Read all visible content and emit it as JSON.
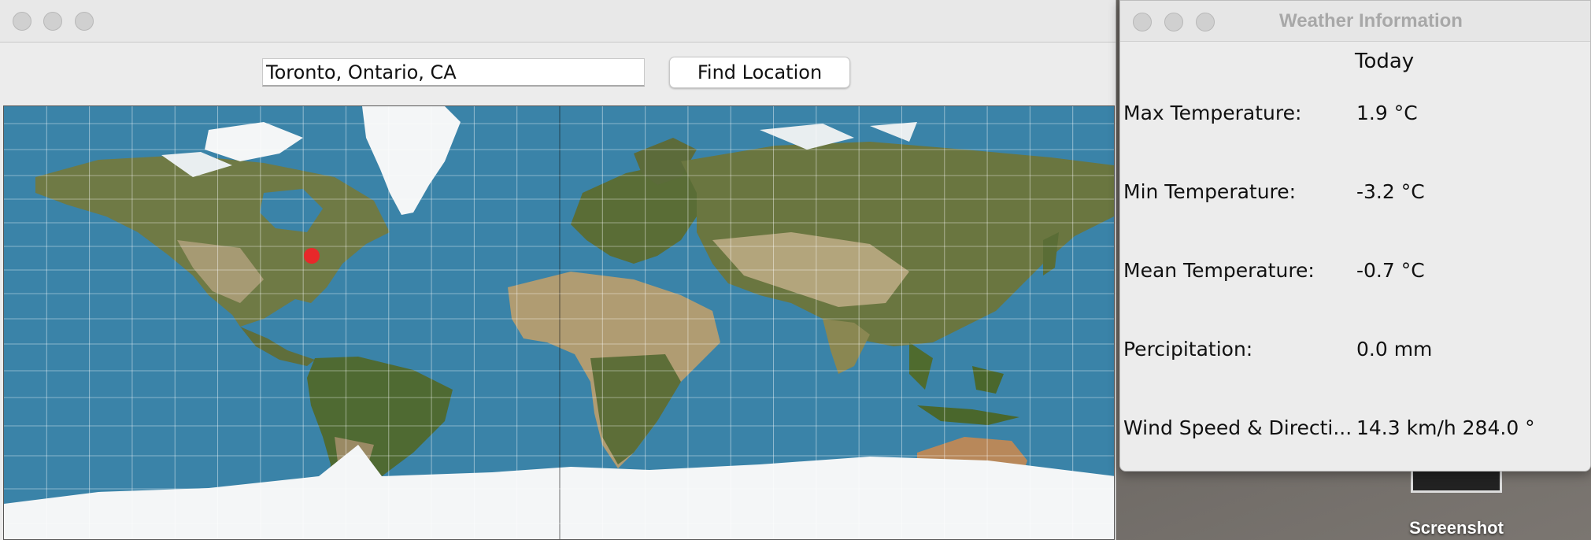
{
  "map_window": {
    "location_input_value": "Toronto, Ontario, CA",
    "find_button_label": "Find Location",
    "map": {
      "marker_color": "#e8282a",
      "ocean_color": "#3a83a8",
      "ice_color": "#f4f6f7"
    }
  },
  "weather_window": {
    "title": "Weather Information",
    "column_header": "Today",
    "rows": [
      {
        "label": "Max Temperature:",
        "value": "1.9 °C"
      },
      {
        "label": "Min Temperature:",
        "value": "-3.2 °C"
      },
      {
        "label": "Mean Temperature:",
        "value": "-0.7 °C"
      },
      {
        "label": "Percipitation:",
        "value": "0.0 mm"
      },
      {
        "label": "Wind Speed & Directi...",
        "value": "14.3 km/h 284.0 °"
      }
    ]
  },
  "desktop": {
    "icon_label": "Screenshot"
  }
}
